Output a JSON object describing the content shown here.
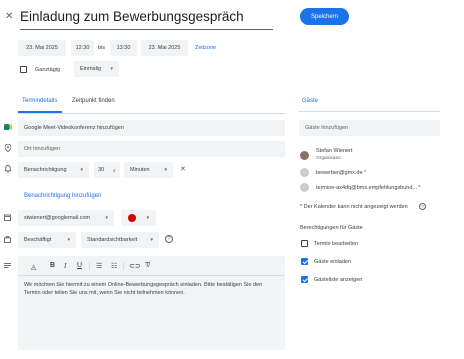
{
  "header": {
    "close_icon": "close-icon",
    "title": "Einladung zum Bewerbungsgespräch",
    "save_label": "Speichern"
  },
  "datetime": {
    "start_date": "23. Mai 2025",
    "start_time": "12:30",
    "separator": "bis",
    "end_time": "13:30",
    "end_date": "23. Mai 2025",
    "timezone_link": "Zeitzone",
    "allday_label": "Ganztägig",
    "allday_checked": false,
    "repeat_value": "Einmalig"
  },
  "tabs": {
    "details": "Termindetails",
    "find_time": "Zeitpunkt finden"
  },
  "details": {
    "meet_label": "Google Meet-Videokonferenz hinzufügen",
    "location_placeholder": "Ort hinzufügen",
    "notification_type": "Benachrichtigung",
    "notification_value": "30",
    "notification_unit": "Minuten",
    "add_notification": "Benachrichtigung hinzufügen",
    "calendar_owner": "stwienert@googlemail.com",
    "calendar_color": "#d50000",
    "availability": "Beschäftigt",
    "visibility": "Standardsichtbarkeit",
    "description": "Wir möchten Sie hiermit zu einem Online-Bewerbungsgespräch einladen. Bitte bestätigen Sie den Termin oder teilen Sie uns mit, wenn Sie nicht teilnehmen können."
  },
  "guests": {
    "title": "Gäste",
    "add_placeholder": "Gäste hinzufügen",
    "list": [
      {
        "name": "Stefan Wienert",
        "role": "Organisator"
      },
      {
        "name": "bewerber@gmx.de *",
        "role": ""
      },
      {
        "name": "termine-ax4dq@bms.empfehlungsbund...  *",
        "role": ""
      }
    ],
    "calendar_note": "* Der Kalender kann nicht angezeigt werden",
    "permissions_title": "Berechtigungen für Gäste",
    "permissions": [
      {
        "label": "Termin bearbeiten",
        "checked": false
      },
      {
        "label": "Gäste einladen",
        "checked": true
      },
      {
        "label": "Gästeliste anzeigen",
        "checked": true
      }
    ]
  },
  "colors": {
    "accent": "#1a73e8",
    "chip_bg": "#f1f3f4"
  }
}
